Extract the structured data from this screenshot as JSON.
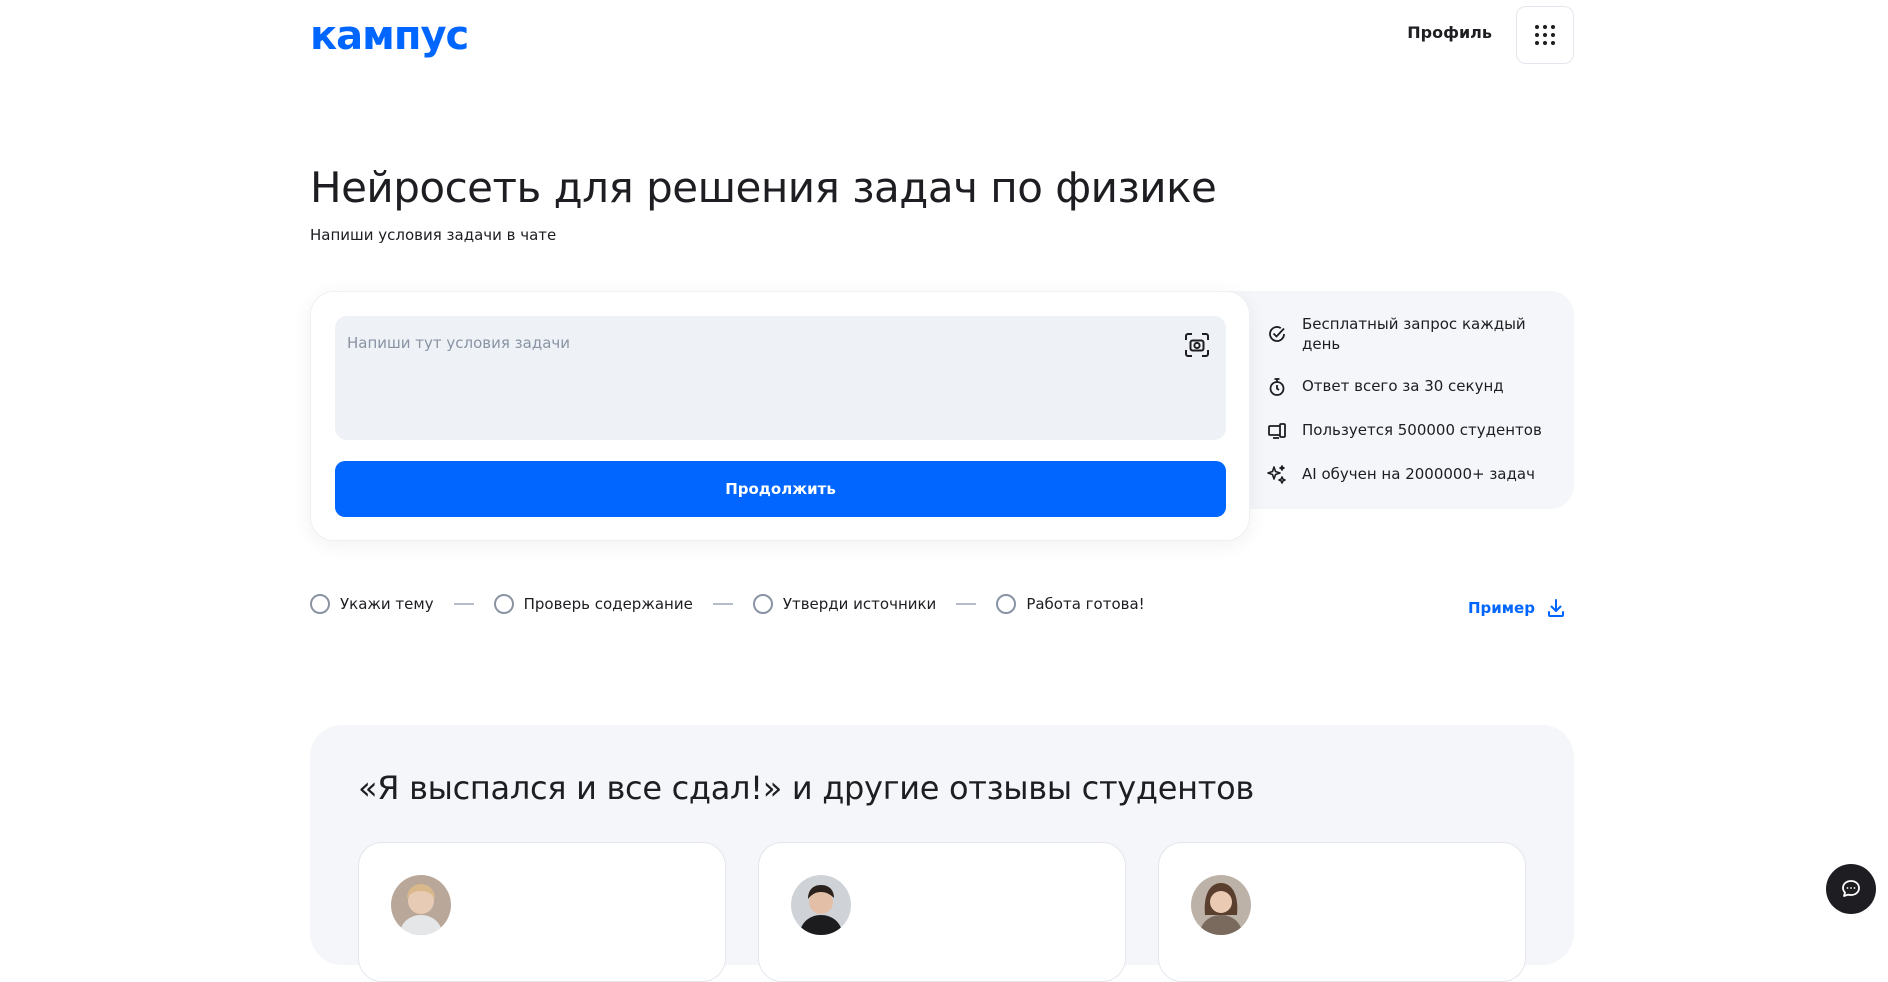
{
  "header": {
    "logo_text": "кампус",
    "profile_label": "Профиль",
    "menu_icon": "grid-dots-icon"
  },
  "hero": {
    "title": "Нейросеть для решения задач по физике",
    "subtitle": "Напиши условия задачи в чате"
  },
  "task_form": {
    "input_placeholder": "Напиши тут условия задачи",
    "input_value": "",
    "camera_icon": "camera-scan-icon",
    "submit_label": "Продолжить"
  },
  "features": [
    {
      "icon": "check-circle-icon",
      "text": "Бесплатный запрос каждый день"
    },
    {
      "icon": "stopwatch-icon",
      "text": "Ответ всего за 30 секунд"
    },
    {
      "icon": "devices-icon",
      "text": "Пользуется 500000 студентов"
    },
    {
      "icon": "sparkles-icon",
      "text": "AI обучен на 2000000+ задач"
    }
  ],
  "steps": [
    {
      "label": "Укажи тему"
    },
    {
      "label": "Проверь содержание"
    },
    {
      "label": "Утверди источники"
    },
    {
      "label": "Работа готова!"
    }
  ],
  "example": {
    "label": "Пример",
    "icon": "download-icon"
  },
  "reviews": {
    "title": "«Я выспался и все сдал!» и другие отзывы студентов"
  },
  "colors": {
    "accent": "#0066ff",
    "text": "#1d1d22",
    "input_bg": "#eef2f7",
    "panel_bg": "#f4f6f9"
  }
}
